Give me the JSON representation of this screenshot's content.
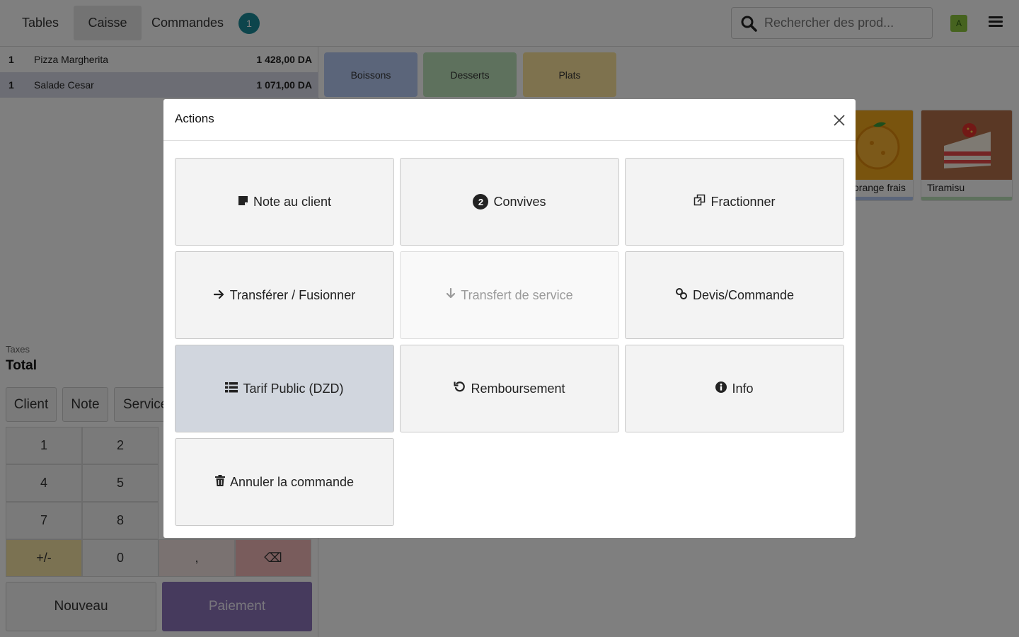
{
  "header": {
    "tabs": [
      {
        "label": "Tables"
      },
      {
        "label": "Caisse",
        "active": true
      },
      {
        "label": "Commandes"
      }
    ],
    "orders_count": "1",
    "search": {
      "placeholder": "Rechercher des prod..."
    },
    "user_initial": "A"
  },
  "order": {
    "lines": [
      {
        "qty": "1",
        "name": "Pizza Margherita",
        "price": "1 428,00 DA"
      },
      {
        "qty": "1",
        "name": "Salade Cesar",
        "price": "1 071,00 DA",
        "selected": true
      }
    ],
    "taxes_label": "Taxes",
    "total_label": "Total"
  },
  "controls": {
    "client": "Client",
    "note": "Note",
    "service": "Service"
  },
  "numpad": {
    "keys": [
      "1",
      "2",
      "4",
      "5",
      "7",
      "8",
      "+/-",
      "0",
      ",",
      "⌫"
    ]
  },
  "buttons": {
    "nouveau": "Nouveau",
    "paiement": "Paiement"
  },
  "categories": [
    {
      "label": "Boissons",
      "color": "#b6cbf5"
    },
    {
      "label": "Desserts",
      "color": "#bde3bb"
    },
    {
      "label": "Plats",
      "color": "#fde49c"
    }
  ],
  "products": [
    {
      "name": "Jus d'orange frais",
      "visible_label": "orange frais",
      "bar_color": "#b6cbf5"
    },
    {
      "name": "Tiramisu",
      "visible_label": "Tiramisu",
      "bar_color": "#bde3bb"
    }
  ],
  "modal": {
    "title": "Actions",
    "actions": [
      {
        "label": "Note au client",
        "icon": "sticky-note-icon"
      },
      {
        "label": "Convives",
        "icon": "guests-badge",
        "badge": "2"
      },
      {
        "label": "Fractionner",
        "icon": "split-icon"
      },
      {
        "label": "Transférer / Fusionner",
        "icon": "arrow-right-icon"
      },
      {
        "label": "Transfert de service",
        "icon": "arrow-down-icon",
        "disabled": true
      },
      {
        "label": "Devis/Commande",
        "icon": "link-icon"
      },
      {
        "label": "Tarif Public (DZD)",
        "icon": "list-icon",
        "highlighted": true
      },
      {
        "label": "Remboursement",
        "icon": "undo-icon"
      },
      {
        "label": "Info",
        "icon": "info-circle-icon"
      },
      {
        "label": "Annuler la commande",
        "icon": "trash-icon"
      }
    ]
  }
}
